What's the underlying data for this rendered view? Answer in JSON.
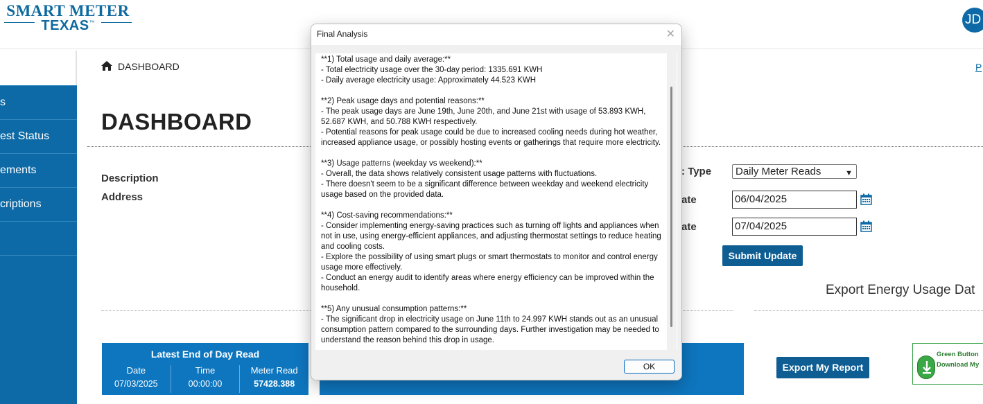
{
  "header": {
    "logo_line1": "SMART METER",
    "logo_line2": "TEXAS",
    "logo_tm": "™",
    "avatar_initials": "JD"
  },
  "sidebar": {
    "items": [
      {
        "label": "s"
      },
      {
        "label": "est Status"
      },
      {
        "label": "ements"
      },
      {
        "label": "criptions"
      },
      {
        "label": ""
      }
    ]
  },
  "breadcrumb": {
    "label": "DASHBOARD"
  },
  "top_link": "P",
  "page_title": "DASHBOARD",
  "info": {
    "description_label": "Description",
    "address_label": "Address"
  },
  "form": {
    "report_type_label": ": Type",
    "report_type_value": "Daily Meter Reads",
    "start_label": "ate",
    "start_value": "06/04/2025",
    "end_label": "ate",
    "end_value": "07/04/2025",
    "submit_label": "Submit Update"
  },
  "export": {
    "title": "Export Energy Usage Dat",
    "button_label": "Export My Report",
    "green_button_line1": "Green Button",
    "green_button_line2": "Download My"
  },
  "latest_read": {
    "title": "Latest End of Day Read",
    "date_label": "Date",
    "date_value": "07/03/2025",
    "time_label": "Time",
    "time_value": "00:00:00",
    "meter_label": "Meter Read",
    "meter_value": "57428.388"
  },
  "dialog": {
    "title": "Final Analysis",
    "close_glyph": "✕",
    "ok_label": "OK",
    "text": "**1) Total usage and daily average:**\n- Total electricity usage over the 30-day period: 1335.691 KWH\n- Daily average electricity usage: Approximately 44.523 KWH\n\n**2) Peak usage days and potential reasons:**\n- The peak usage days are June 19th, June 20th, and June 21st with usage of 53.893 KWH, 52.687 KWH, and 50.788 KWH respectively.\n- Potential reasons for peak usage could be due to increased cooling needs during hot weather, increased appliance usage, or possibly hosting events or gatherings that require more electricity.\n\n**3) Usage patterns (weekday vs weekend):**\n- Overall, the data shows relatively consistent usage patterns with fluctuations.\n- There doesn't seem to be a significant difference between weekday and weekend electricity usage based on the provided data.\n\n**4) Cost-saving recommendations:**\n- Consider implementing energy-saving practices such as turning off lights and appliances when not in use, using energy-efficient appliances, and adjusting thermostat settings to reduce heating and cooling costs.\n- Explore the possibility of using smart plugs or smart thermostats to monitor and control energy usage more effectively.\n- Conduct an energy audit to identify areas where energy efficiency can be improved within the household.\n\n**5) Any unusual consumption patterns:**\n- The significant drop in electricity usage on June 11th to 24.997 KWH stands out as an unusual consumption pattern compared to the surrounding days. Further investigation may be needed to understand the reason behind this drop in usage."
  }
}
